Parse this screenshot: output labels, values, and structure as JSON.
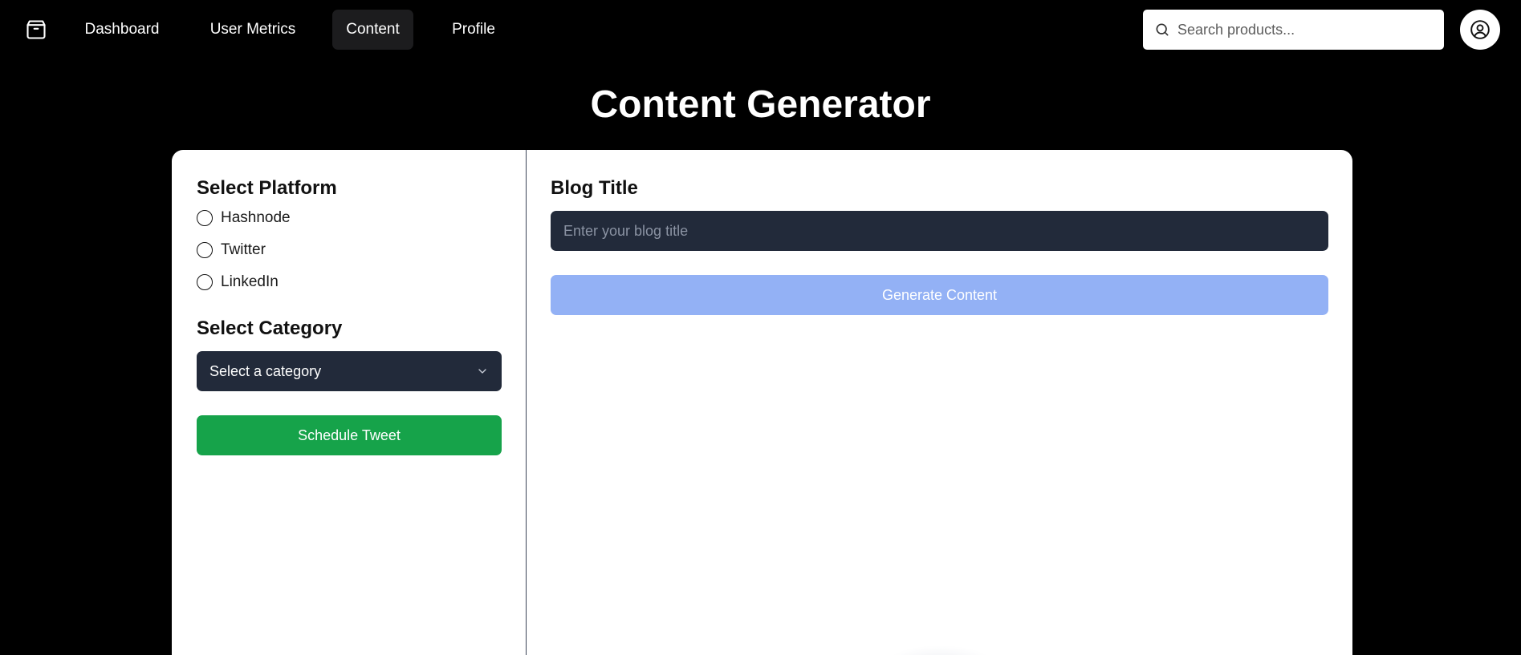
{
  "nav": {
    "logo_icon": "package-box-icon",
    "links": [
      {
        "label": "Dashboard",
        "active": false
      },
      {
        "label": "User Metrics",
        "active": false
      },
      {
        "label": "Content",
        "active": true
      },
      {
        "label": "Profile",
        "active": false
      }
    ],
    "search": {
      "placeholder": "Search products...",
      "value": "",
      "icon": "search-icon"
    },
    "avatar_icon": "user-circle-icon"
  },
  "page": {
    "title": "Content Generator"
  },
  "left": {
    "platform_label": "Select Platform",
    "platforms": [
      "Hashnode",
      "Twitter",
      "LinkedIn"
    ],
    "category_label": "Select Category",
    "category_select": {
      "value": "Select a category",
      "icon": "chevron-down-icon"
    },
    "schedule_button": "Schedule Tweet"
  },
  "right": {
    "blog_title_label": "Blog Title",
    "blog_title_input": {
      "placeholder": "Enter your blog title",
      "value": ""
    },
    "generate_button": "Generate Content"
  },
  "colors": {
    "background": "#000000",
    "panel": "#ffffff",
    "input_dark": "#222a3a",
    "schedule_green": "#16a34a",
    "generate_blue": "#93b1f5",
    "nav_active": "#1c1c1e"
  }
}
